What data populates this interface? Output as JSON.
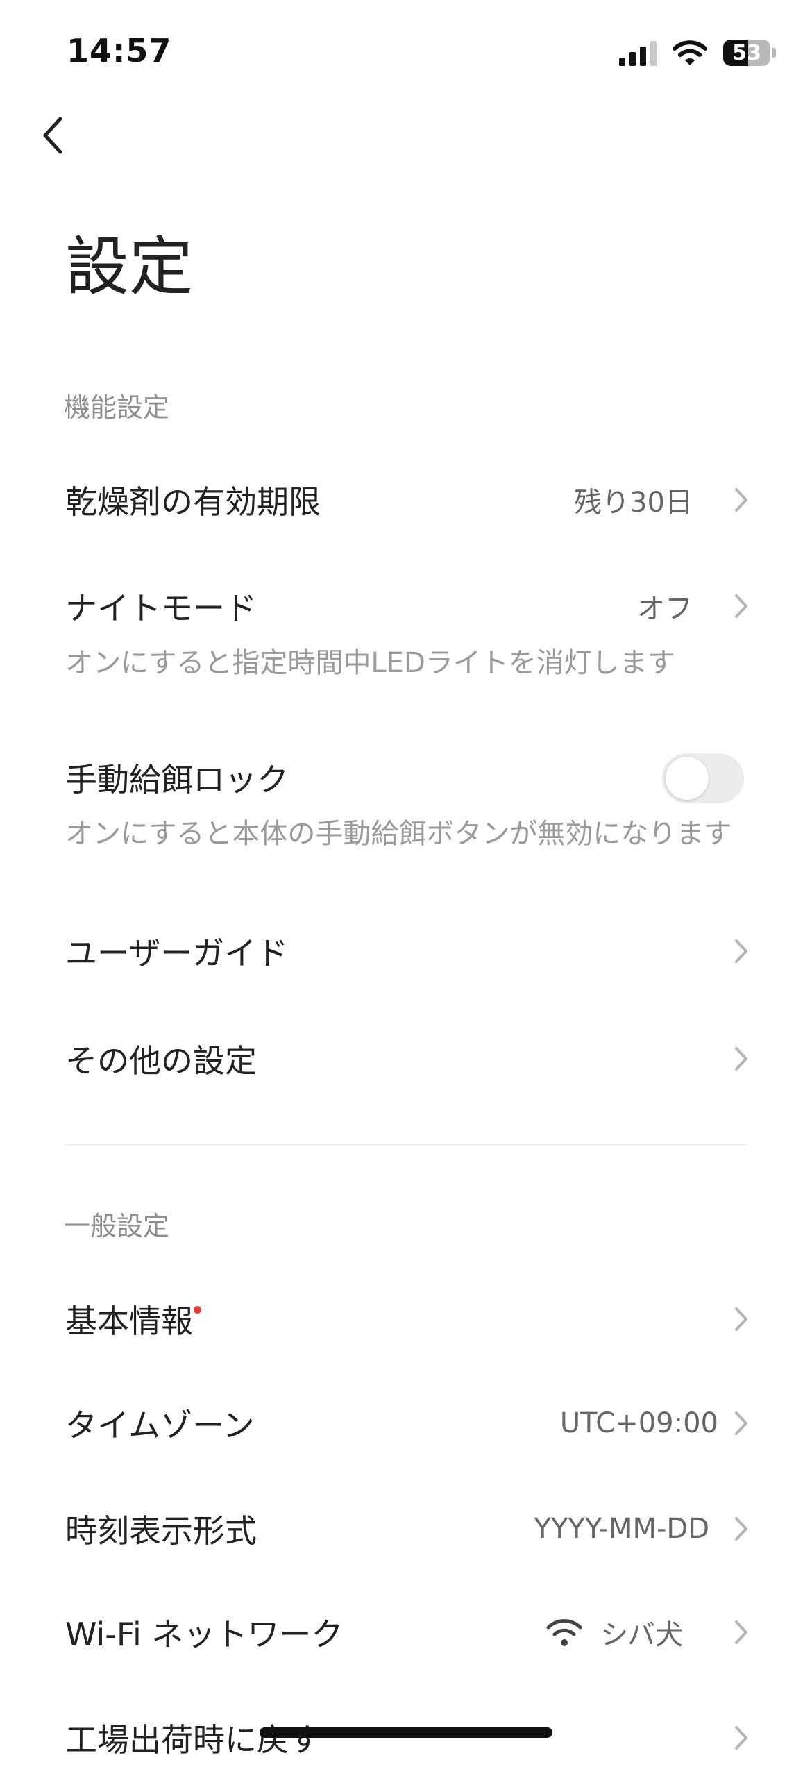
{
  "status_bar": {
    "time": "14:57",
    "battery": "53",
    "battery_level": 0.53,
    "icons": [
      "cellular-signal-icon",
      "wifi-icon",
      "battery-icon"
    ]
  },
  "nav": {
    "back_icon": "chevron-left-icon"
  },
  "page": {
    "title": "設定"
  },
  "sections": {
    "function": {
      "header": "機能設定",
      "desiccant": {
        "label": "乾燥剤の有効期限",
        "value": "残り30日"
      },
      "night_mode": {
        "label": "ナイトモード",
        "value": "オフ",
        "description": "オンにすると指定時間中LEDライトを消灯します"
      },
      "manual_feed_lock": {
        "label": "手動給餌ロック",
        "enabled": false,
        "description": "オンにすると本体の手動給餌ボタンが無効になります"
      },
      "user_guide": {
        "label": "ユーザーガイド"
      },
      "other_settings": {
        "label": "その他の設定"
      }
    },
    "general": {
      "header": "一般設定",
      "basic_info": {
        "label": "基本情報",
        "has_notification": true
      },
      "timezone": {
        "label": "タイムゾーン",
        "value": "UTC+09:00"
      },
      "time_format": {
        "label": "時刻表示形式",
        "value": "YYYY-MM-DD"
      },
      "wifi": {
        "label": "Wi-Fi ネットワーク",
        "value": "シバ犬",
        "icon": "wifi-icon"
      },
      "factory_reset": {
        "label": "工場出荷時に戻す"
      }
    }
  },
  "colors": {
    "background": "#ffffff",
    "text_primary": "#222222",
    "text_secondary": "#9a9a9a",
    "chevron": "#b5b5b5",
    "notification_dot": "#e53935",
    "toggle_off": "#ececec"
  }
}
